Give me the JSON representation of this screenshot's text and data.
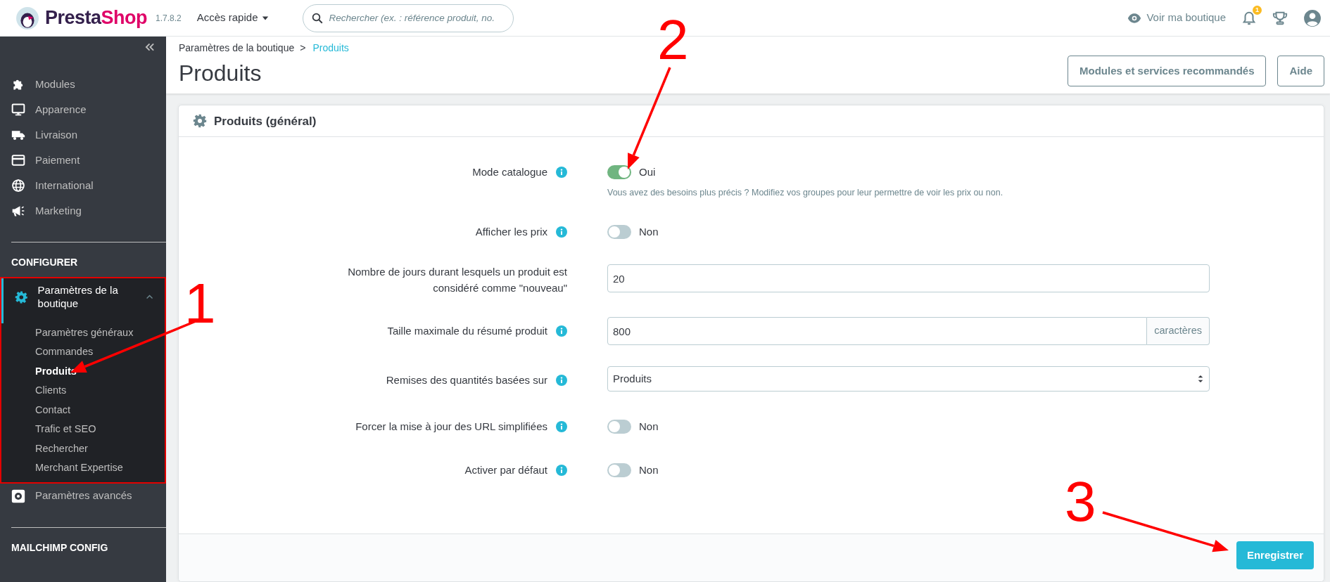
{
  "topbar": {
    "brand": [
      "Presta",
      "Shop"
    ],
    "version": "1.7.8.2",
    "quick_access": "Accès rapide",
    "search": {
      "placeholder": "Rechercher (ex. : référence produit, no."
    },
    "view_shop": "Voir ma boutique",
    "notifications_badge": "1"
  },
  "sidebar": {
    "items": [
      {
        "kind": "item",
        "label": "Modules"
      },
      {
        "kind": "item",
        "label": "Apparence"
      },
      {
        "kind": "item",
        "label": "Livraison"
      },
      {
        "kind": "item",
        "label": "Paiement"
      },
      {
        "kind": "item",
        "label": "International"
      },
      {
        "kind": "item",
        "label": "Marketing"
      },
      {
        "kind": "heading",
        "label": "CONFIGURER"
      },
      {
        "kind": "group",
        "label": "Paramètres de la boutique",
        "expanded": true,
        "highlighted": true,
        "children": [
          {
            "label": "Paramètres généraux",
            "selected": false
          },
          {
            "label": "Commandes",
            "selected": false
          },
          {
            "label": "Produits",
            "selected": true
          },
          {
            "label": "Clients",
            "selected": false
          },
          {
            "label": "Contact",
            "selected": false
          },
          {
            "label": "Trafic et SEO",
            "selected": false
          },
          {
            "label": "Rechercher",
            "selected": false
          },
          {
            "label": "Merchant Expertise",
            "selected": false
          }
        ]
      },
      {
        "kind": "item",
        "label": "Paramètres avancés"
      },
      {
        "kind": "heading",
        "label": "MAILCHIMP CONFIG"
      }
    ]
  },
  "header": {
    "breadcrumb": [
      "Paramètres de la boutique",
      "Produits"
    ],
    "breadcrumb_separator": ">",
    "title": "Produits",
    "buttons": [
      "Modules et services recommandés",
      "Aide"
    ]
  },
  "panel": {
    "title": "Produits (général)",
    "fields": [
      {
        "kind": "switch",
        "label": "Mode catalogue",
        "info": true,
        "on": true,
        "value": "Oui",
        "help": "Vous avez des besoins plus précis ? Modifiez vos groupes pour leur permettre de voir les prix ou non."
      },
      {
        "kind": "switch",
        "label": "Afficher les prix",
        "info": true,
        "on": false,
        "value": "Non"
      },
      {
        "kind": "input",
        "label": "Nombre de jours durant lesquels un produit est considéré comme \"nouveau\"",
        "info": false,
        "value": "20"
      },
      {
        "kind": "input",
        "label": "Taille maximale du résumé produit",
        "info": true,
        "value": "800",
        "suffix": "caractères"
      },
      {
        "kind": "select",
        "label": "Remises des quantités basées sur",
        "info": true,
        "value": "Produits"
      },
      {
        "kind": "switch",
        "label": "Forcer la mise à jour des URL simplifiées",
        "info": true,
        "on": false,
        "value": "Non"
      },
      {
        "kind": "switch",
        "label": "Activer par défaut",
        "info": true,
        "on": false,
        "value": "Non"
      }
    ],
    "save": "Enregistrer"
  },
  "annotations": [
    {
      "label": "1"
    },
    {
      "label": "2"
    },
    {
      "label": "3"
    }
  ]
}
